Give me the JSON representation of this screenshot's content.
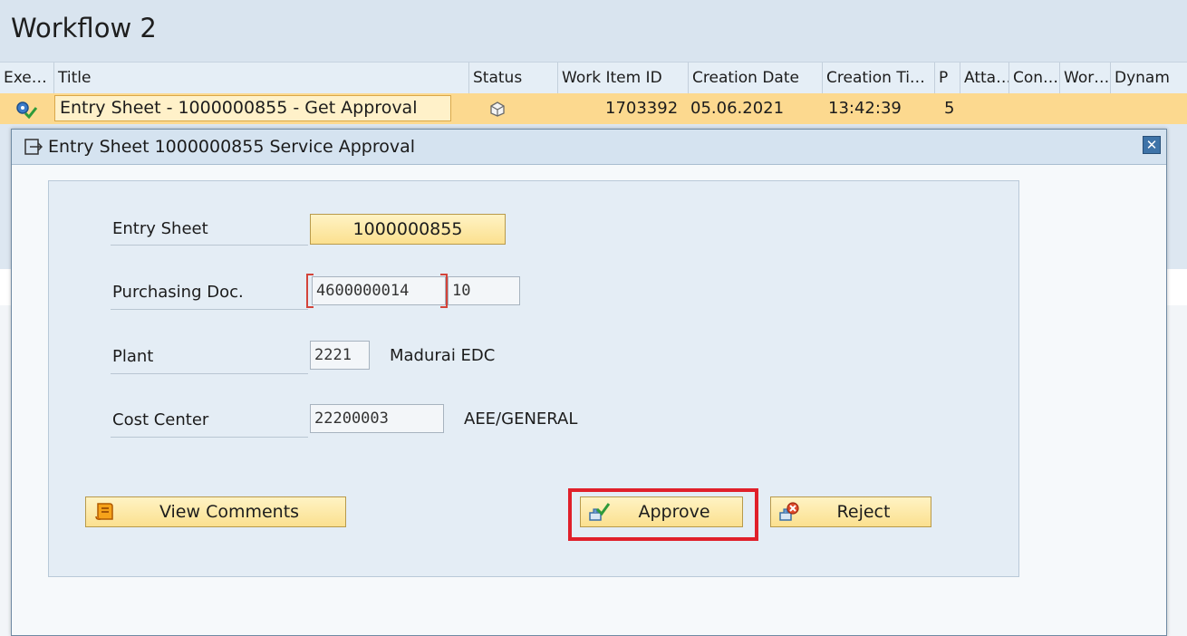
{
  "header": {
    "title": "Workflow 2"
  },
  "columns": [
    "Exe…",
    "Title",
    "Status",
    "Work Item ID",
    "Creation Date",
    "Creation Ti…",
    "P",
    "Atta…",
    "Con…",
    "Wor…",
    "Dynam"
  ],
  "row": {
    "title": "Entry Sheet - 1000000855 - Get Approval",
    "work_item_id": "1703392",
    "creation_date": "05.06.2021",
    "creation_time": "13:42:39",
    "priority": "5"
  },
  "dialog": {
    "title": "Entry Sheet 1000000855 Service Approval",
    "close_icon": "close-icon",
    "fields": {
      "entry_sheet": {
        "label": "Entry Sheet",
        "value": "1000000855"
      },
      "purchasing_doc": {
        "label": "Purchasing Doc.",
        "value": "4600000014",
        "item": "10"
      },
      "plant": {
        "label": "Plant",
        "value": "2221",
        "description": "Madurai EDC"
      },
      "cost_center": {
        "label": "Cost Center",
        "value": "22200003",
        "description": "AEE/GENERAL"
      }
    },
    "buttons": {
      "view_comments": "View Comments",
      "approve": "Approve",
      "reject": "Reject"
    }
  },
  "colors": {
    "accent": "#fcd98f",
    "highlight": "#e0202a",
    "header_bg": "#d9e4ef"
  }
}
